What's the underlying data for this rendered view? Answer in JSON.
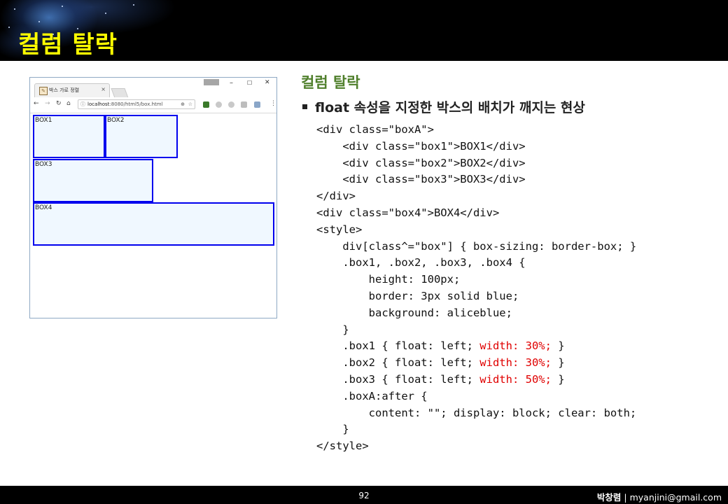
{
  "slide": {
    "title": "컬럼 탈락",
    "heading": "컬럼 탈락",
    "bullet": "float 속성을 지정한 박스의 배치가 깨지는 현상"
  },
  "browser": {
    "tab_title": "박스 가로 정렬",
    "tab_close": "×",
    "url_host": "localhost",
    "url_path": ":8080/html5/box.html",
    "win_minimize": "–",
    "win_maximize": "☐",
    "win_close": "✕",
    "boxes": [
      {
        "label": "BOX1"
      },
      {
        "label": "BOX2"
      },
      {
        "label": "BOX3"
      },
      {
        "label": "BOX4"
      }
    ]
  },
  "code_lines": [
    {
      "indent": "",
      "text": "<div class=\"boxA\">",
      "hl": ""
    },
    {
      "indent": "    ",
      "text": "<div class=\"box1\">BOX1</div>",
      "hl": ""
    },
    {
      "indent": "    ",
      "text": "<div class=\"box2\">BOX2</div>",
      "hl": ""
    },
    {
      "indent": "    ",
      "text": "<div class=\"box3\">BOX3</div>",
      "hl": ""
    },
    {
      "indent": "",
      "text": "</div>",
      "hl": ""
    },
    {
      "indent": "",
      "text": "<div class=\"box4\">BOX4</div>",
      "hl": ""
    },
    {
      "indent": "",
      "text": "<style>",
      "hl": ""
    },
    {
      "indent": "    ",
      "text": "div[class^=\"box\"] { box-sizing: border-box; }",
      "hl": ""
    },
    {
      "indent": "    ",
      "text": ".box1, .box2, .box3, .box4 {",
      "hl": ""
    },
    {
      "indent": "        ",
      "text": "height: 100px;",
      "hl": ""
    },
    {
      "indent": "        ",
      "text": "border: 3px solid blue;",
      "hl": ""
    },
    {
      "indent": "        ",
      "text": "background: aliceblue;",
      "hl": ""
    },
    {
      "indent": "    ",
      "text": "}",
      "hl": ""
    },
    {
      "indent": "    ",
      "text": ".box1 { float: left; ",
      "hl": "width: 30%;",
      "tail": " }"
    },
    {
      "indent": "    ",
      "text": ".box2 { float: left; ",
      "hl": "width: 30%;",
      "tail": " }"
    },
    {
      "indent": "    ",
      "text": ".box3 { float: left; ",
      "hl": "width: 50%;",
      "tail": " }"
    },
    {
      "indent": "    ",
      "text": ".boxA:after {",
      "hl": ""
    },
    {
      "indent": "        ",
      "text": "content: \"\"; display: block; clear: both;",
      "hl": ""
    },
    {
      "indent": "    ",
      "text": "}",
      "hl": ""
    },
    {
      "indent": "",
      "text": "</style>",
      "hl": ""
    }
  ],
  "footer": {
    "page_number": "92",
    "author": "박창렴",
    "separator": " | ",
    "email": "myanjini@gmail.com"
  },
  "colors": {
    "title": "#ffff00",
    "heading": "#4f7f2b",
    "highlight": "#e00000",
    "box_border": "#0000ee",
    "box_fill": "#f0f8ff"
  }
}
